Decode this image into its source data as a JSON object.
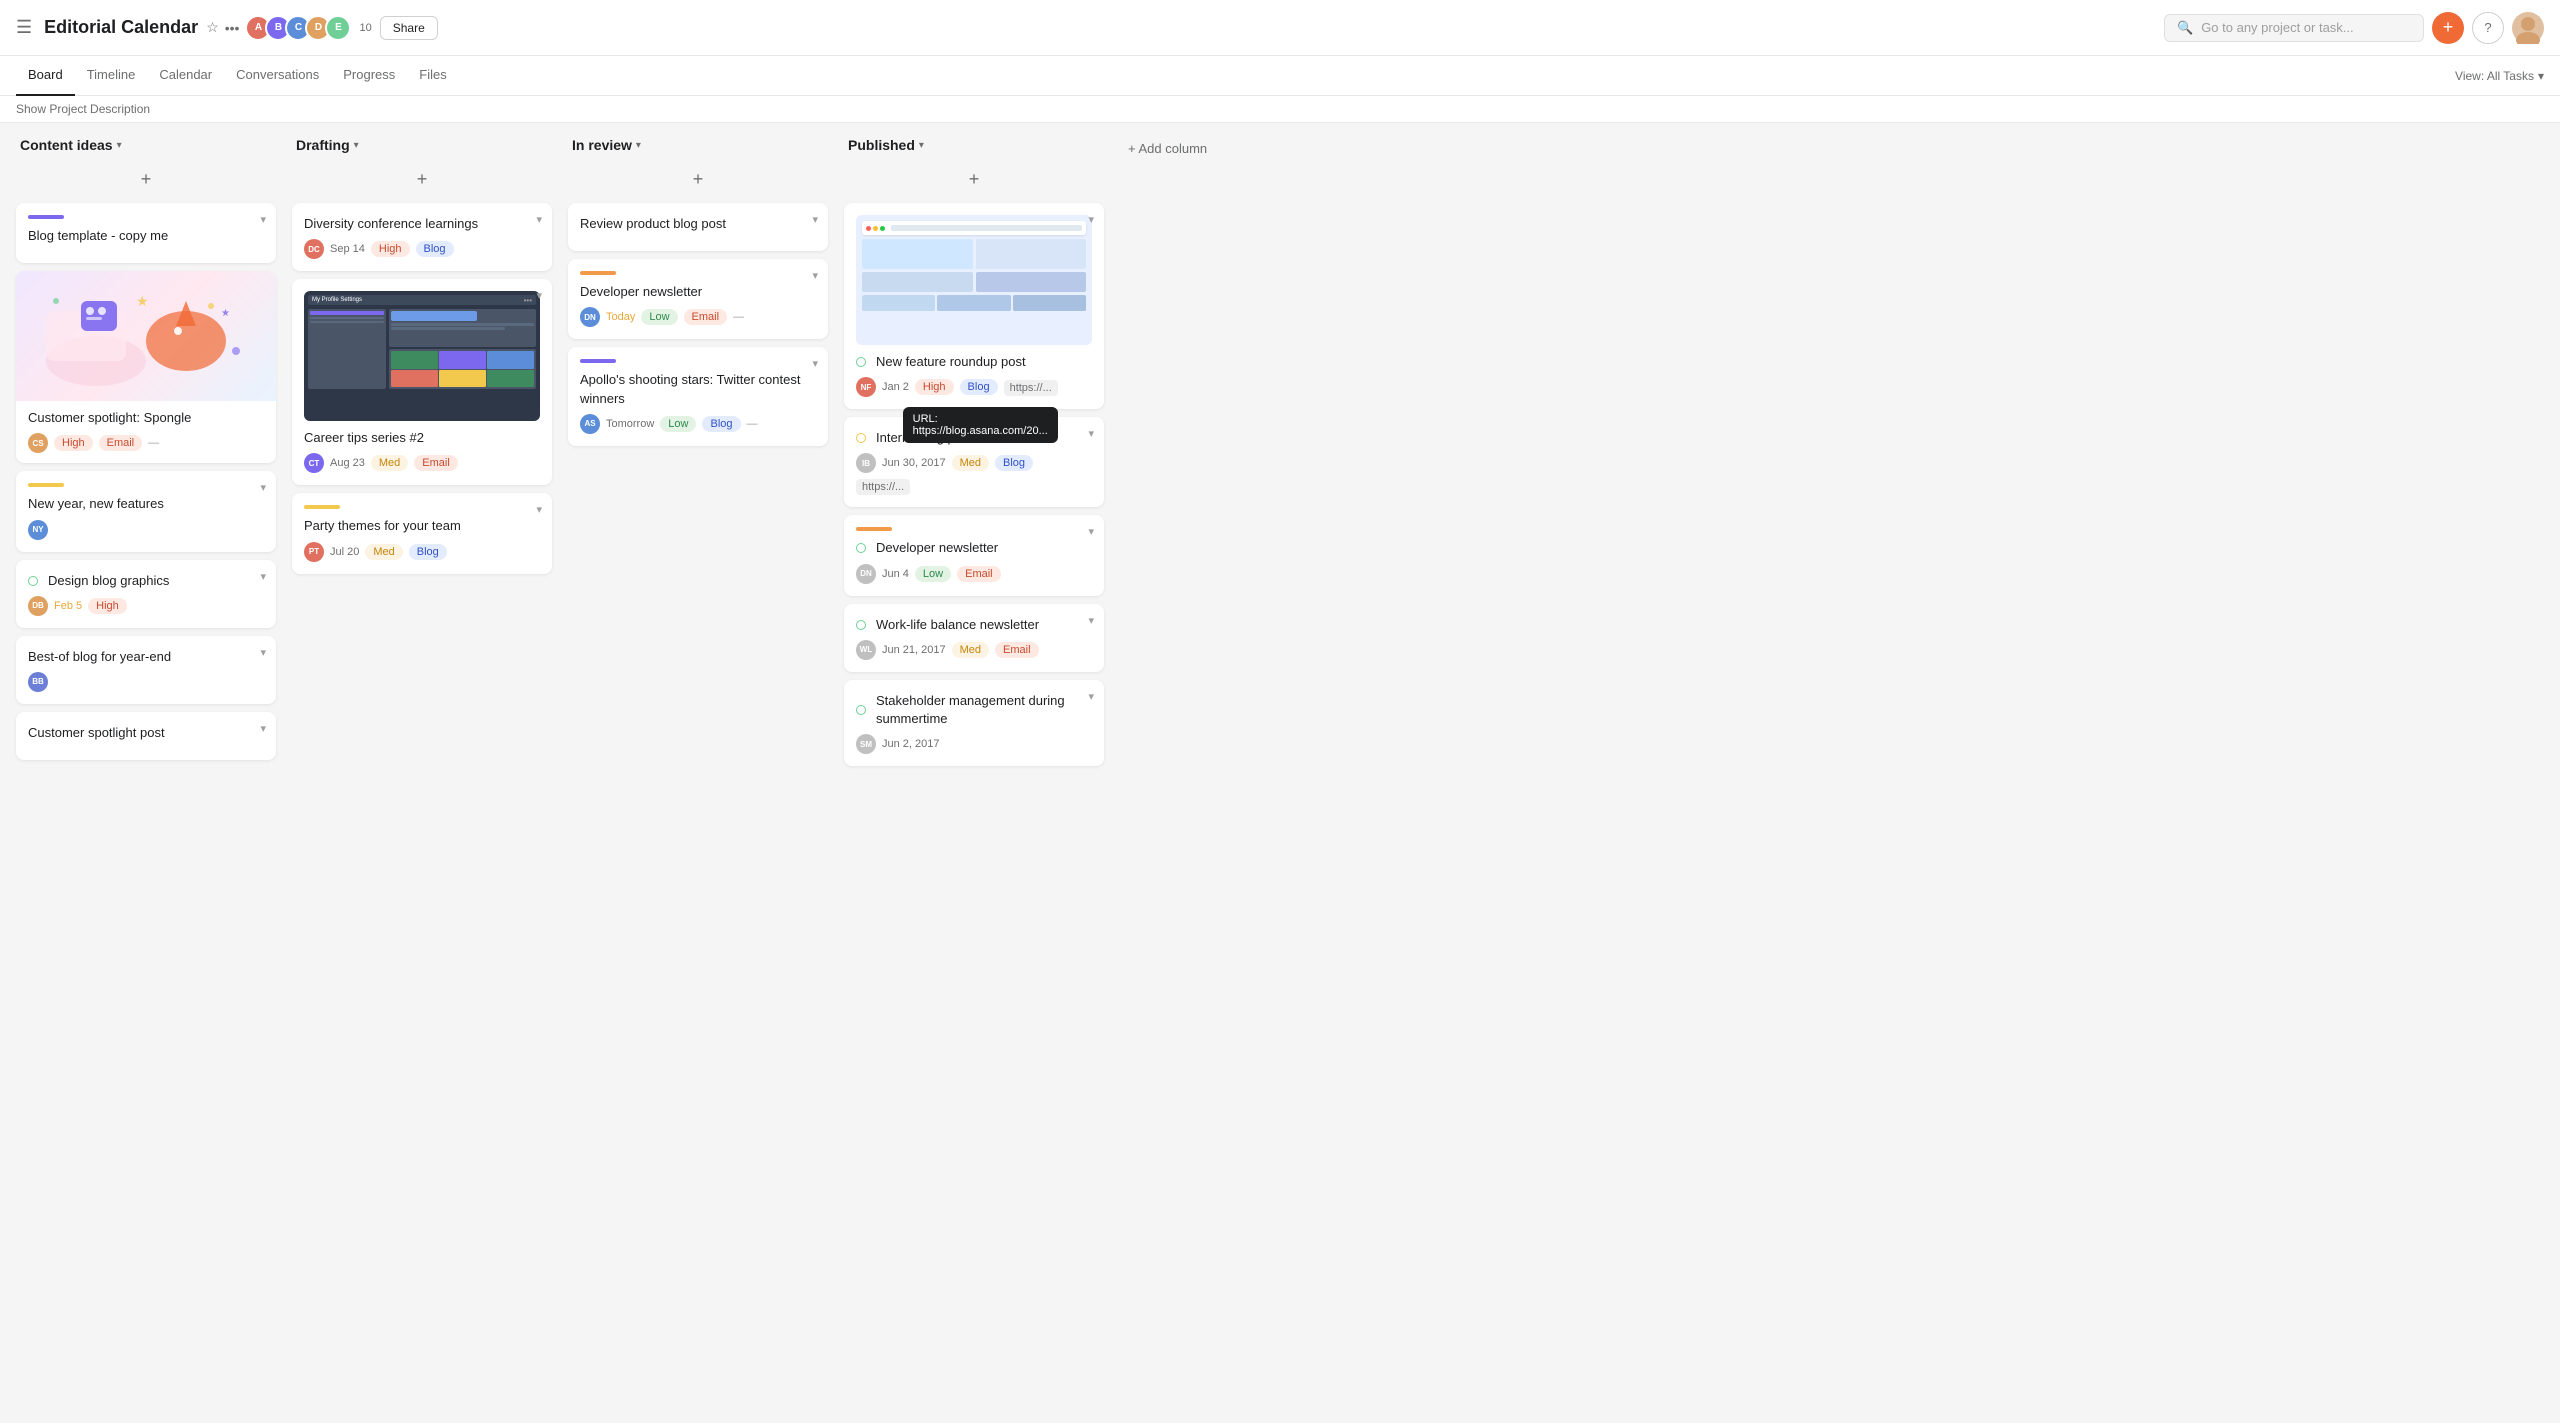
{
  "app": {
    "title": "Editorial Calendar",
    "search_placeholder": "Go to any project or task...",
    "member_count": "10",
    "share_label": "Share"
  },
  "sub_nav": {
    "items": [
      "Board",
      "Timeline",
      "Calendar",
      "Conversations",
      "Progress",
      "Files"
    ],
    "active": "Board",
    "show_desc": "Show Project Description",
    "view_all": "View: All Tasks"
  },
  "columns": [
    {
      "id": "content-ideas",
      "title": "Content ideas",
      "cards": [
        {
          "id": "blog-template",
          "bar_color": "#7c68ee",
          "title": "Blog template - copy me",
          "has_image": false,
          "has_illustration": true
        },
        {
          "id": "customer-spotlight-spongle",
          "bar_color": null,
          "title": "Customer spotlight: Spongle",
          "avatar_color": "#e0a060",
          "avatar_initials": "CS",
          "tags": [
            {
              "label": "High",
              "type": "high"
            },
            {
              "label": "Email",
              "type": "email"
            }
          ],
          "tag_more": "—"
        },
        {
          "id": "new-year-features",
          "bar_color": "#f2c94c",
          "title": "New year, new features",
          "avatar_color": "#5b8dd9",
          "avatar_initials": "NY",
          "has_dot": true,
          "dot_type": "green"
        },
        {
          "id": "design-blog-graphics",
          "bar_color": null,
          "title": "Design blog graphics",
          "has_dot": true,
          "dot_type": "green",
          "date": "Feb 5",
          "date_color": "#e8a838",
          "avatar_color": "#e0a060",
          "avatar_initials": "DB",
          "tags": [
            {
              "label": "High",
              "type": "high"
            }
          ]
        },
        {
          "id": "best-of-blog",
          "bar_color": null,
          "title": "Best-of blog for year-end",
          "avatar_color": "#6b7fd7",
          "avatar_initials": "BB"
        },
        {
          "id": "customer-spotlight-post",
          "bar_color": null,
          "title": "Customer spotlight post"
        }
      ]
    },
    {
      "id": "drafting",
      "title": "Drafting",
      "cards": [
        {
          "id": "diversity-conference",
          "bar_color": null,
          "title": "Diversity conference learnings",
          "date": "Sep 14",
          "avatar_color": "#e07060",
          "avatar_initials": "DC",
          "tags": [
            {
              "label": "High",
              "type": "high"
            },
            {
              "label": "Blog",
              "type": "blog"
            }
          ]
        },
        {
          "id": "career-tips",
          "bar_color": null,
          "has_screenshot": true,
          "title": "Career tips series #2",
          "date": "Aug 23",
          "avatar_color": "#7c68ee",
          "avatar_initials": "CT",
          "tags": [
            {
              "label": "Med",
              "type": "med"
            },
            {
              "label": "Email",
              "type": "email"
            }
          ]
        },
        {
          "id": "party-themes",
          "bar_color": "#f2c94c",
          "title": "Party themes for your team",
          "date": "Jul 20",
          "avatar_color": "#e07060",
          "avatar_initials": "PT",
          "tags": [
            {
              "label": "Med",
              "type": "med"
            },
            {
              "label": "Blog",
              "type": "blog"
            }
          ]
        }
      ]
    },
    {
      "id": "in-review",
      "title": "In review",
      "cards": [
        {
          "id": "review-product-blog",
          "bar_color": null,
          "title": "Review product blog post"
        },
        {
          "id": "developer-newsletter",
          "bar_color": "#f2994a",
          "title": "Developer newsletter",
          "date": "Today",
          "date_type": "today",
          "avatar_color": "#5b8dd9",
          "avatar_initials": "DN",
          "tags": [
            {
              "label": "Low",
              "type": "low"
            },
            {
              "label": "Email",
              "type": "email"
            }
          ],
          "tag_more": "—"
        },
        {
          "id": "apollo-shooting-stars",
          "bar_color": "#7c68ee",
          "title": "Apollo's shooting stars: Twitter contest winners",
          "date": "Tomorrow",
          "date_type": "tomorrow",
          "avatar_color": "#5b8dd9",
          "avatar_initials": "AS",
          "tags": [
            {
              "label": "Low",
              "type": "low"
            },
            {
              "label": "Blog",
              "type": "blog"
            }
          ],
          "tag_more": "—"
        }
      ]
    },
    {
      "id": "published",
      "title": "Published",
      "cards": [
        {
          "id": "new-feature-roundup",
          "has_pub_screenshot": true,
          "has_dot": true,
          "dot_type": "green",
          "title": "New feature roundup post",
          "date": "Jan 2",
          "avatar_color": "#e07060",
          "avatar_initials": "NF",
          "tags": [
            {
              "label": "High",
              "type": "high"
            },
            {
              "label": "Blog",
              "type": "blog"
            }
          ],
          "url": "https://...",
          "url_tooltip": "URL: https://blog.asana.com/20...",
          "show_tooltip": true
        },
        {
          "id": "interns-blog-post",
          "has_dot": true,
          "dot_type": "yellow",
          "title": "Interns blog post",
          "date": "Jun 30, 2017",
          "avatar_color": "#c0c0c0",
          "avatar_initials": "IB",
          "tags": [
            {
              "label": "Med",
              "type": "med"
            },
            {
              "label": "Blog",
              "type": "blog"
            }
          ],
          "url": "https://..."
        },
        {
          "id": "developer-newsletter-pub",
          "bar_color": "#f2994a",
          "has_dot": true,
          "dot_type": "green",
          "title": "Developer newsletter",
          "date": "Jun 4",
          "avatar_color": "#c0c0c0",
          "avatar_initials": "DN",
          "tags": [
            {
              "label": "Low",
              "type": "low"
            },
            {
              "label": "Email",
              "type": "email"
            }
          ]
        },
        {
          "id": "work-life-balance",
          "has_dot": true,
          "dot_type": "green",
          "title": "Work-life balance newsletter",
          "date": "Jun 21, 2017",
          "avatar_color": "#c0c0c0",
          "avatar_initials": "WL",
          "tags": [
            {
              "label": "Med",
              "type": "med"
            },
            {
              "label": "Email",
              "type": "email"
            }
          ]
        },
        {
          "id": "stakeholder-management",
          "has_dot": true,
          "dot_type": "green",
          "title": "Stakeholder management during summertime",
          "date": "Jun 2, 2017",
          "avatar_color": "#c0c0c0",
          "avatar_initials": "SM"
        }
      ]
    }
  ],
  "add_column": "+ Add column",
  "tag_types": {
    "high": {
      "bg": "#fde8e2",
      "color": "#c84b2f"
    },
    "med": {
      "bg": "#fdf3e3",
      "color": "#c4850a"
    },
    "low": {
      "bg": "#e3f3e3",
      "color": "#2d8a4e"
    },
    "blog": {
      "bg": "#e3ecff",
      "color": "#3050c4"
    },
    "email": {
      "bg": "#fde8e2",
      "color": "#c84b2f"
    }
  },
  "avatars": [
    {
      "color": "#e07060",
      "initials": "A"
    },
    {
      "color": "#7c68ee",
      "initials": "B"
    },
    {
      "color": "#5b8dd9",
      "initials": "C"
    },
    {
      "color": "#e0a060",
      "initials": "D"
    },
    {
      "color": "#6fcf97",
      "initials": "E"
    }
  ]
}
